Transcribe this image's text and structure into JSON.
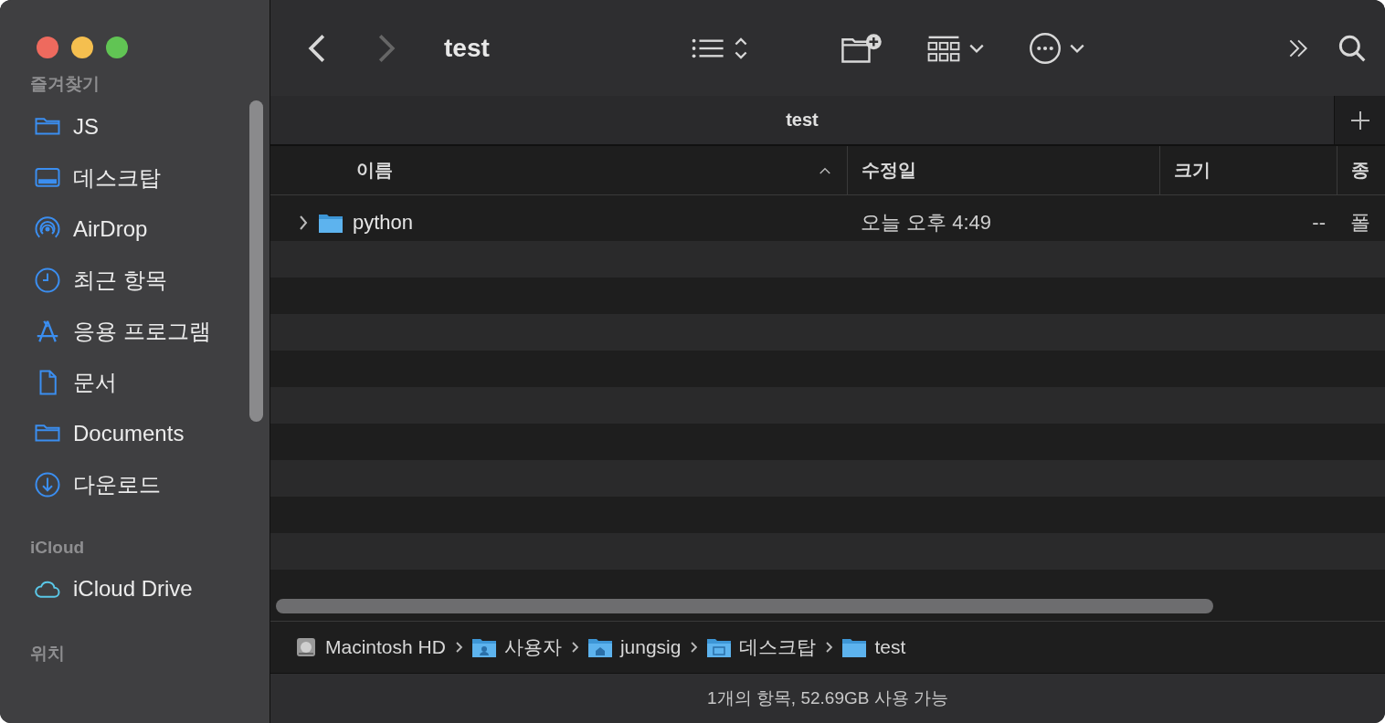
{
  "window": {
    "title": "test"
  },
  "nav": {
    "back_disabled": false,
    "forward_disabled": true
  },
  "sidebar": {
    "sections": [
      {
        "title": "즐겨찾기",
        "items": [
          {
            "label": "JS"
          },
          {
            "label": "데스크탑"
          },
          {
            "label": "AirDrop"
          },
          {
            "label": "최근 항목"
          },
          {
            "label": "응용 프로그램"
          },
          {
            "label": "문서"
          },
          {
            "label": "Documents"
          },
          {
            "label": "다운로드"
          }
        ]
      },
      {
        "title": "iCloud",
        "items": [
          {
            "label": "iCloud Drive"
          }
        ]
      },
      {
        "title": "위치"
      }
    ]
  },
  "tabs": [
    {
      "label": "test",
      "selected": true
    }
  ],
  "table": {
    "columns": [
      {
        "label": "이름",
        "sorted": true
      },
      {
        "label": "수정일",
        "sorted": false
      },
      {
        "label": "크기",
        "sorted": false
      },
      {
        "label": "종",
        "sorted": false
      }
    ],
    "rows": [
      {
        "name": "python",
        "modified": "오늘 오후 4:49",
        "size": "--",
        "kind": "폴",
        "expanded": false
      }
    ]
  },
  "path_bar": [
    {
      "label": "Macintosh HD"
    },
    {
      "label": "사용자"
    },
    {
      "label": "jungsig"
    },
    {
      "label": "데스크탑"
    },
    {
      "label": "test"
    }
  ],
  "status_bar": "1개의 항목, 52.69GB 사용 가능"
}
